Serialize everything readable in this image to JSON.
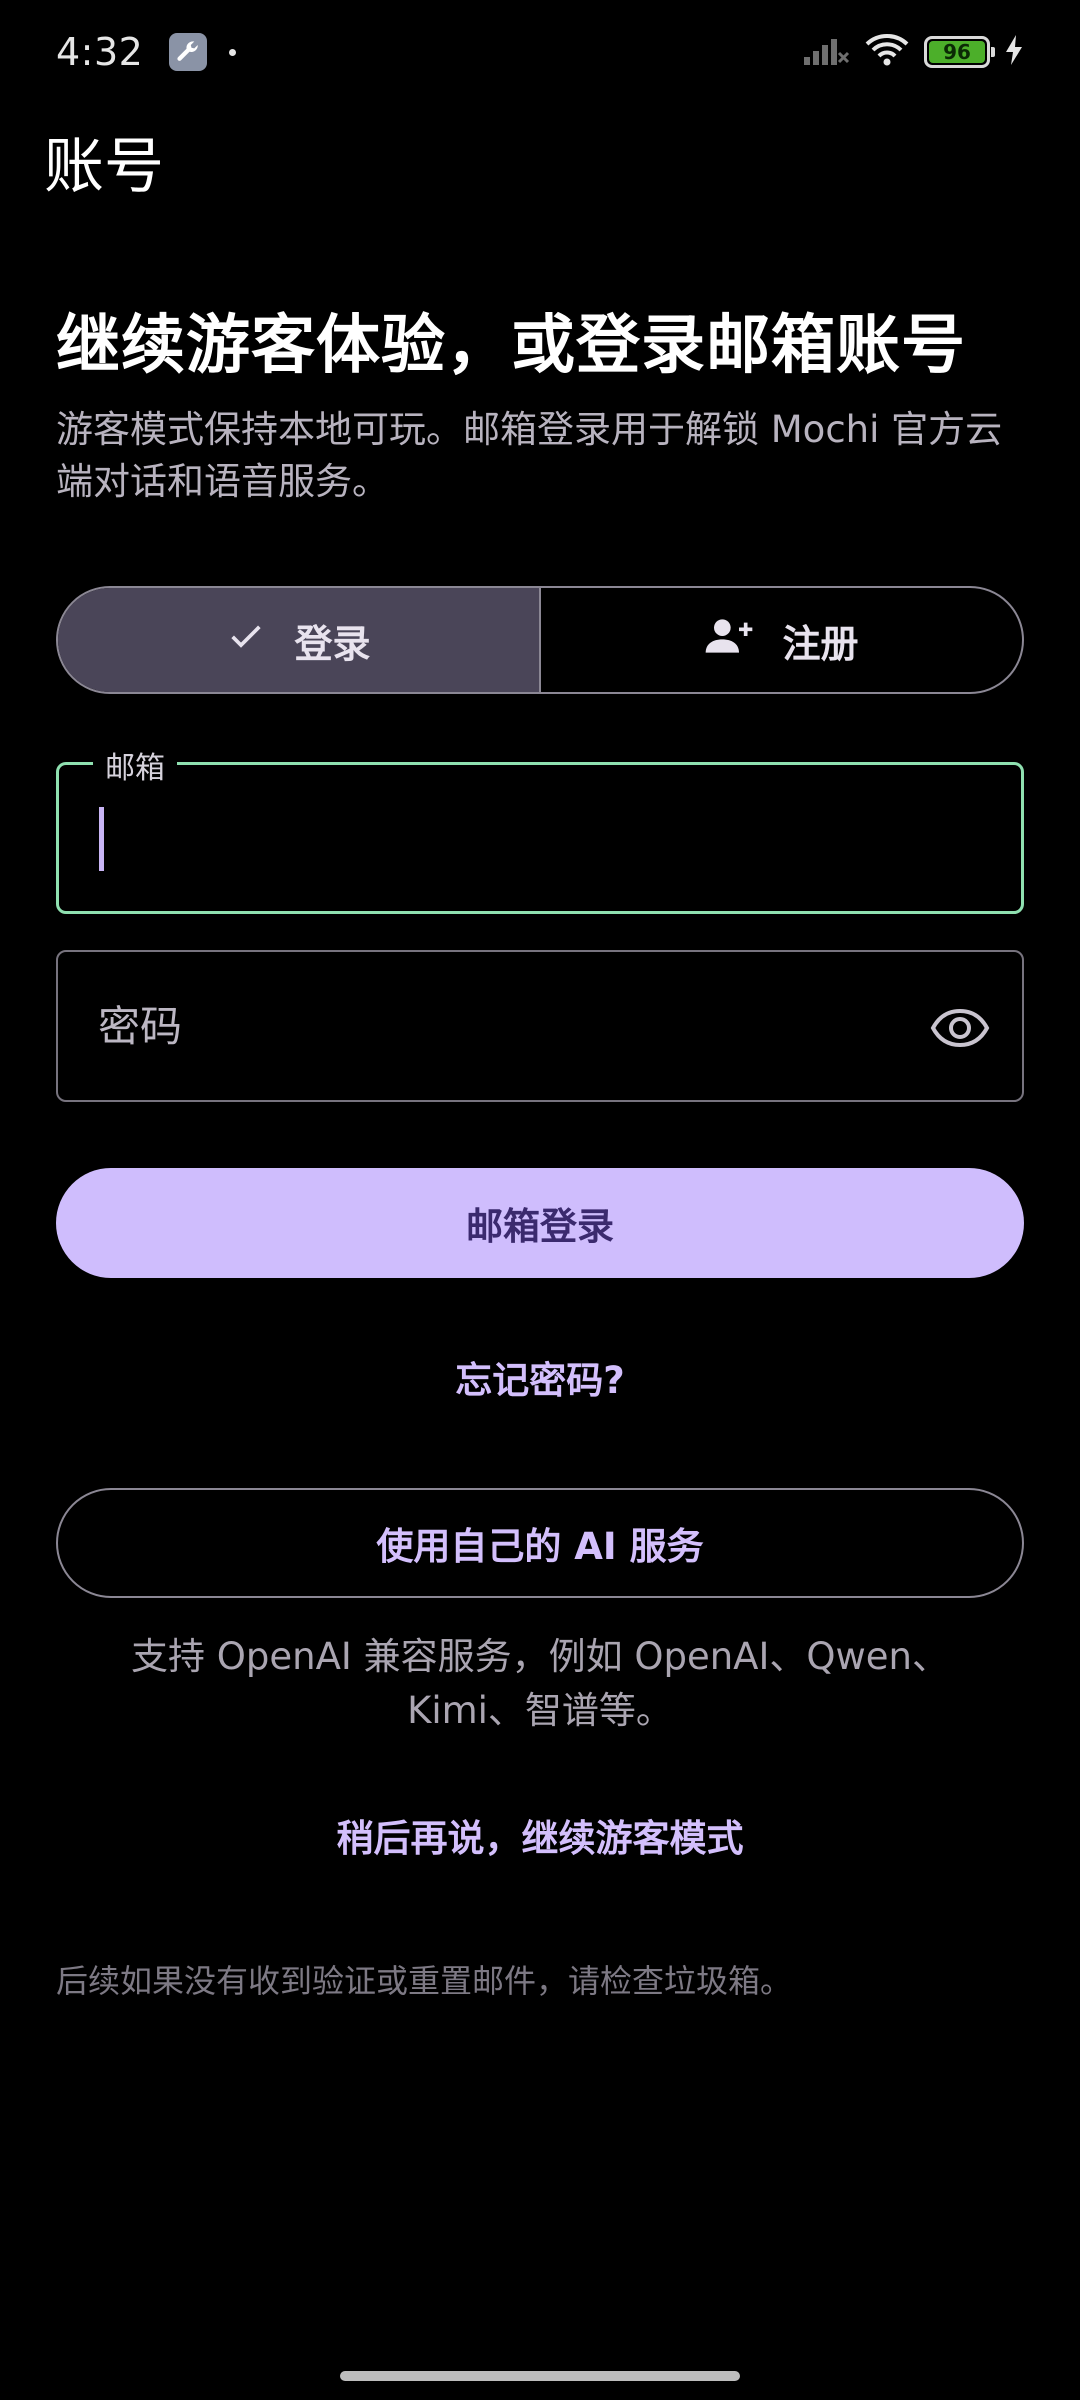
{
  "status_bar": {
    "time": "4:32",
    "battery_level": "96",
    "icons": [
      "wrench-icon",
      "signal-icon",
      "wifi-icon",
      "battery-icon",
      "charging-icon"
    ]
  },
  "app_bar": {
    "title": "账号"
  },
  "headline": "继续游客体验，或登录邮箱账号",
  "subtitle": "游客模式保持本地可玩。邮箱登录用于解锁 Mochi 官方云端对话和语音服务。",
  "auth_tabs": {
    "login_label": "登录",
    "register_label": "注册",
    "selected": "login"
  },
  "email_field": {
    "label": "邮箱",
    "value": ""
  },
  "password_field": {
    "placeholder": "密码",
    "value": ""
  },
  "buttons": {
    "email_login": "邮箱登录",
    "forgot_password": "忘记密码?",
    "own_ai_service": "使用自己的 AI 服务",
    "continue_guest": "稍后再说，继续游客模式"
  },
  "support_text": "支持 OpenAI 兼容服务，例如 OpenAI、Qwen、Kimi、智谱等。",
  "footnote": "后续如果没有收到验证或重置邮件，请检查垃圾箱。",
  "colors": {
    "background": "#000000",
    "primary": "#cfbdfd",
    "primary_text": "#3b2a6e",
    "focus_border": "#8fe0b0",
    "selected_segment": "#4a4558"
  }
}
